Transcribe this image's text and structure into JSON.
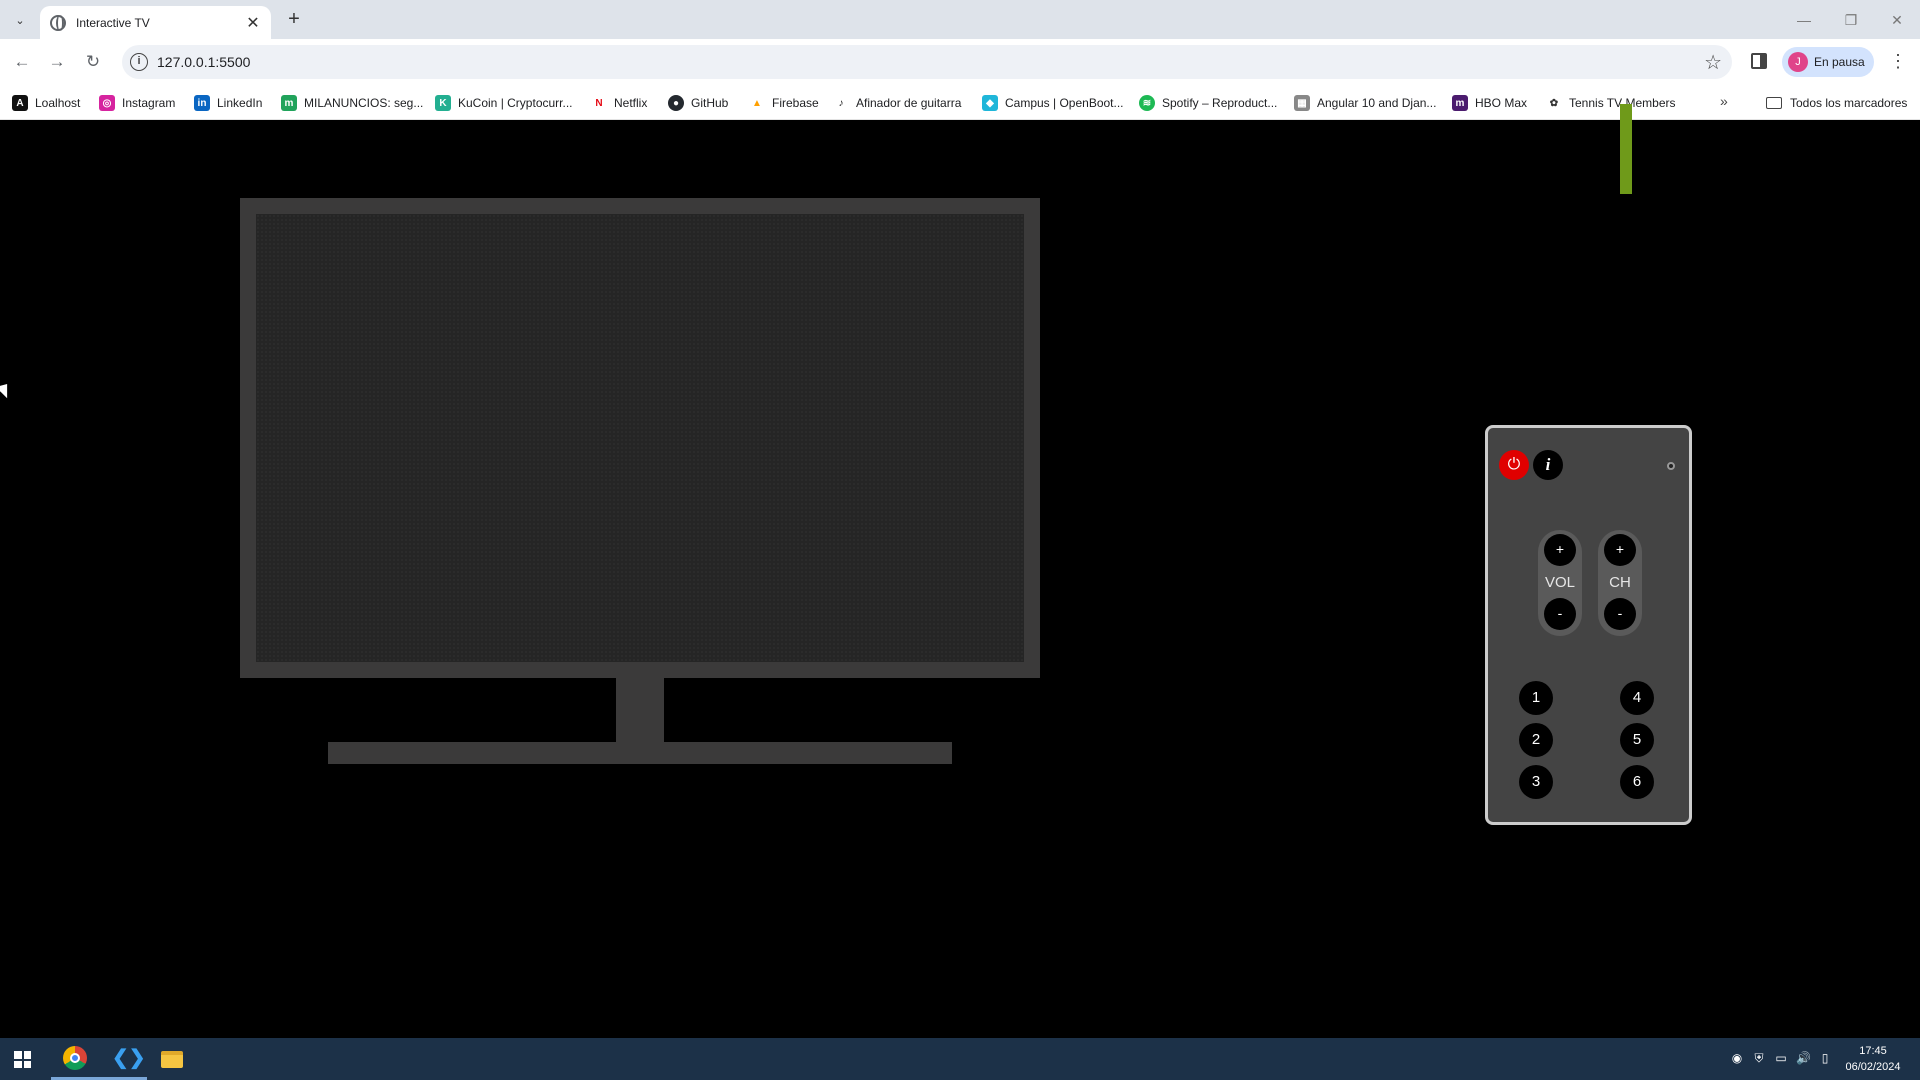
{
  "browser": {
    "tab_title": "Interactive TV",
    "url": "127.0.0.1:5500",
    "profile_initial": "J",
    "profile_label": "En pausa"
  },
  "bookmarks": [
    {
      "label": "Loalhost",
      "icon": "localhost-icon",
      "color": "#111111"
    },
    {
      "label": "Instagram",
      "icon": "instagram-icon",
      "color": "#d6249f"
    },
    {
      "label": "LinkedIn",
      "icon": "linkedin-icon",
      "color": "#0a66c2"
    },
    {
      "label": "MILANUNCIOS: seg...",
      "icon": "milanuncios-icon",
      "color": "#21a35b"
    },
    {
      "label": "KuCoin | Cryptocurr...",
      "icon": "kucoin-icon",
      "color": "#23af91"
    },
    {
      "label": "Netflix",
      "icon": "netflix-icon",
      "color": "#e50914"
    },
    {
      "label": "GitHub",
      "icon": "github-icon",
      "color": "#24292f"
    },
    {
      "label": "Firebase",
      "icon": "firebase-icon",
      "color": "#ffa000"
    },
    {
      "label": "Afinador de guitarra",
      "icon": "guitar-icon",
      "color": "#222222"
    },
    {
      "label": "Campus | OpenBoot...",
      "icon": "campus-icon",
      "color": "#1fb6d9"
    },
    {
      "label": "Spotify – Reproduct...",
      "icon": "spotify-icon",
      "color": "#1db954"
    },
    {
      "label": "Angular 10 and Djan...",
      "icon": "angular-icon",
      "color": "#888888"
    },
    {
      "label": "HBO Max",
      "icon": "hbomax-icon",
      "color": "#4b1b6e"
    },
    {
      "label": "Tennis TV Members",
      "icon": "tennis-icon",
      "color": "#333333"
    }
  ],
  "bookmarks_all": "Todos los marcadores",
  "remote": {
    "info_label": "i",
    "vol_label": "VOL",
    "ch_label": "CH",
    "plus": "+",
    "minus": "-",
    "numbers": [
      "1",
      "2",
      "3",
      "4",
      "5",
      "6"
    ],
    "power_color": "#e00000"
  },
  "taskbar": {
    "time": "17:45",
    "date": "06/02/2024"
  }
}
